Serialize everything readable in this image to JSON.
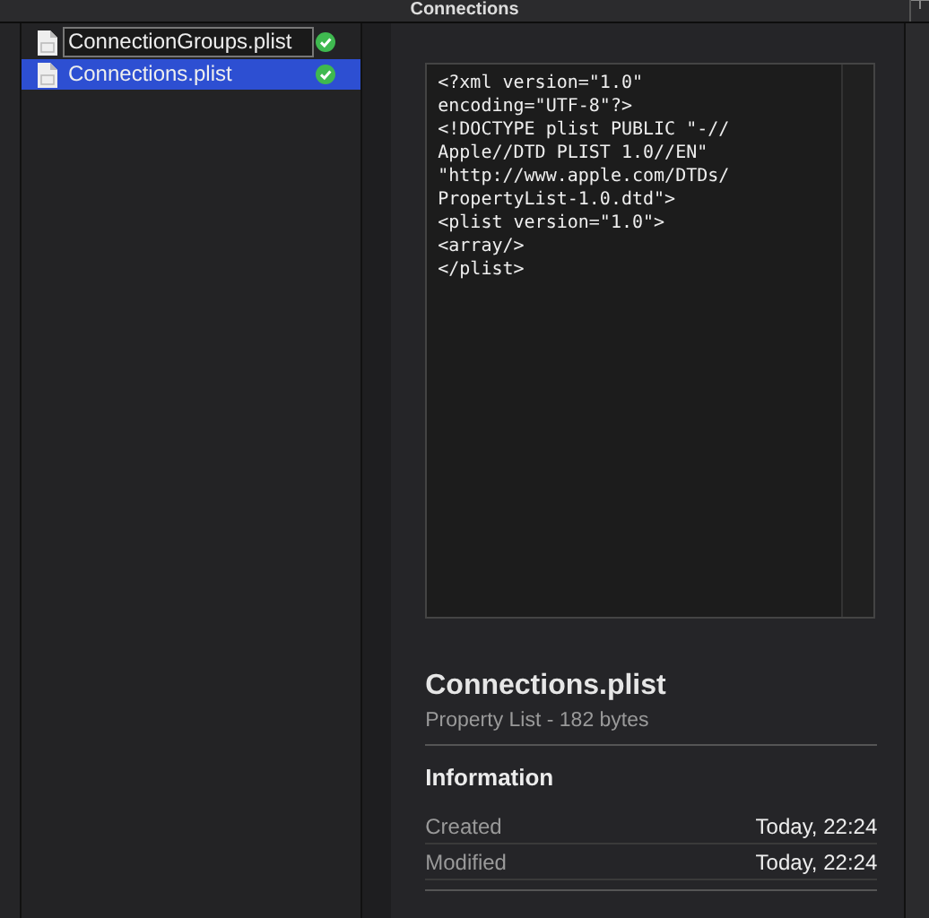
{
  "window": {
    "title": "Connections"
  },
  "files": [
    {
      "name": "ConnectionGroups.plist",
      "selected": false,
      "editing": true,
      "synced": true
    },
    {
      "name": "Connections.plist",
      "selected": true,
      "editing": false,
      "synced": true
    }
  ],
  "preview": {
    "code_lines": [
      "<?xml version=\"1.0\"",
      "encoding=\"UTF-8\"?>",
      "<!DOCTYPE plist PUBLIC \"-//",
      "Apple//DTD PLIST 1.0//EN\"",
      "\"http://www.apple.com/DTDs/",
      "PropertyList-1.0.dtd\">",
      "<plist version=\"1.0\">",
      "<array/>",
      "</plist>"
    ],
    "file_name": "Connections.plist",
    "file_info": "Property List - 182 bytes",
    "section": "Information",
    "rows": [
      {
        "label": "Created",
        "value": "Today, 22:24"
      },
      {
        "label": "Modified",
        "value": "Today, 22:24"
      }
    ]
  }
}
